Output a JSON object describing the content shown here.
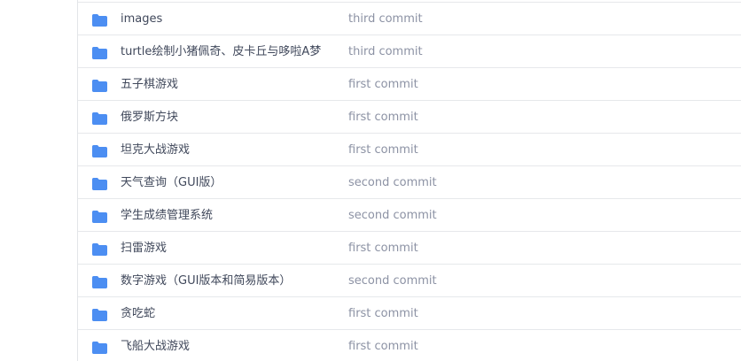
{
  "colors": {
    "folder_icon": "#4c8ef2",
    "name_text": "#40485b",
    "commit_text": "#8c92a4",
    "divider": "#e6e8eb"
  },
  "file_list": {
    "rows": [
      {
        "name": "images",
        "commit": "third commit",
        "icon": "folder-icon"
      },
      {
        "name": "turtle绘制小猪佩奇、皮卡丘与哆啦A梦",
        "commit": "third commit",
        "icon": "folder-icon"
      },
      {
        "name": "五子棋游戏",
        "commit": "first commit",
        "icon": "folder-icon"
      },
      {
        "name": "俄罗斯方块",
        "commit": "first commit",
        "icon": "folder-icon"
      },
      {
        "name": "坦克大战游戏",
        "commit": "first commit",
        "icon": "folder-icon"
      },
      {
        "name": "天气查询（GUI版）",
        "commit": "second commit",
        "icon": "folder-icon"
      },
      {
        "name": "学生成绩管理系统",
        "commit": "second commit",
        "icon": "folder-icon"
      },
      {
        "name": "扫雷游戏",
        "commit": "first commit",
        "icon": "folder-icon"
      },
      {
        "name": "数字游戏（GUI版本和简易版本）",
        "commit": "second commit",
        "icon": "folder-icon"
      },
      {
        "name": "贪吃蛇",
        "commit": "first commit",
        "icon": "folder-icon"
      },
      {
        "name": "飞船大战游戏",
        "commit": "first commit",
        "icon": "folder-icon"
      }
    ]
  }
}
